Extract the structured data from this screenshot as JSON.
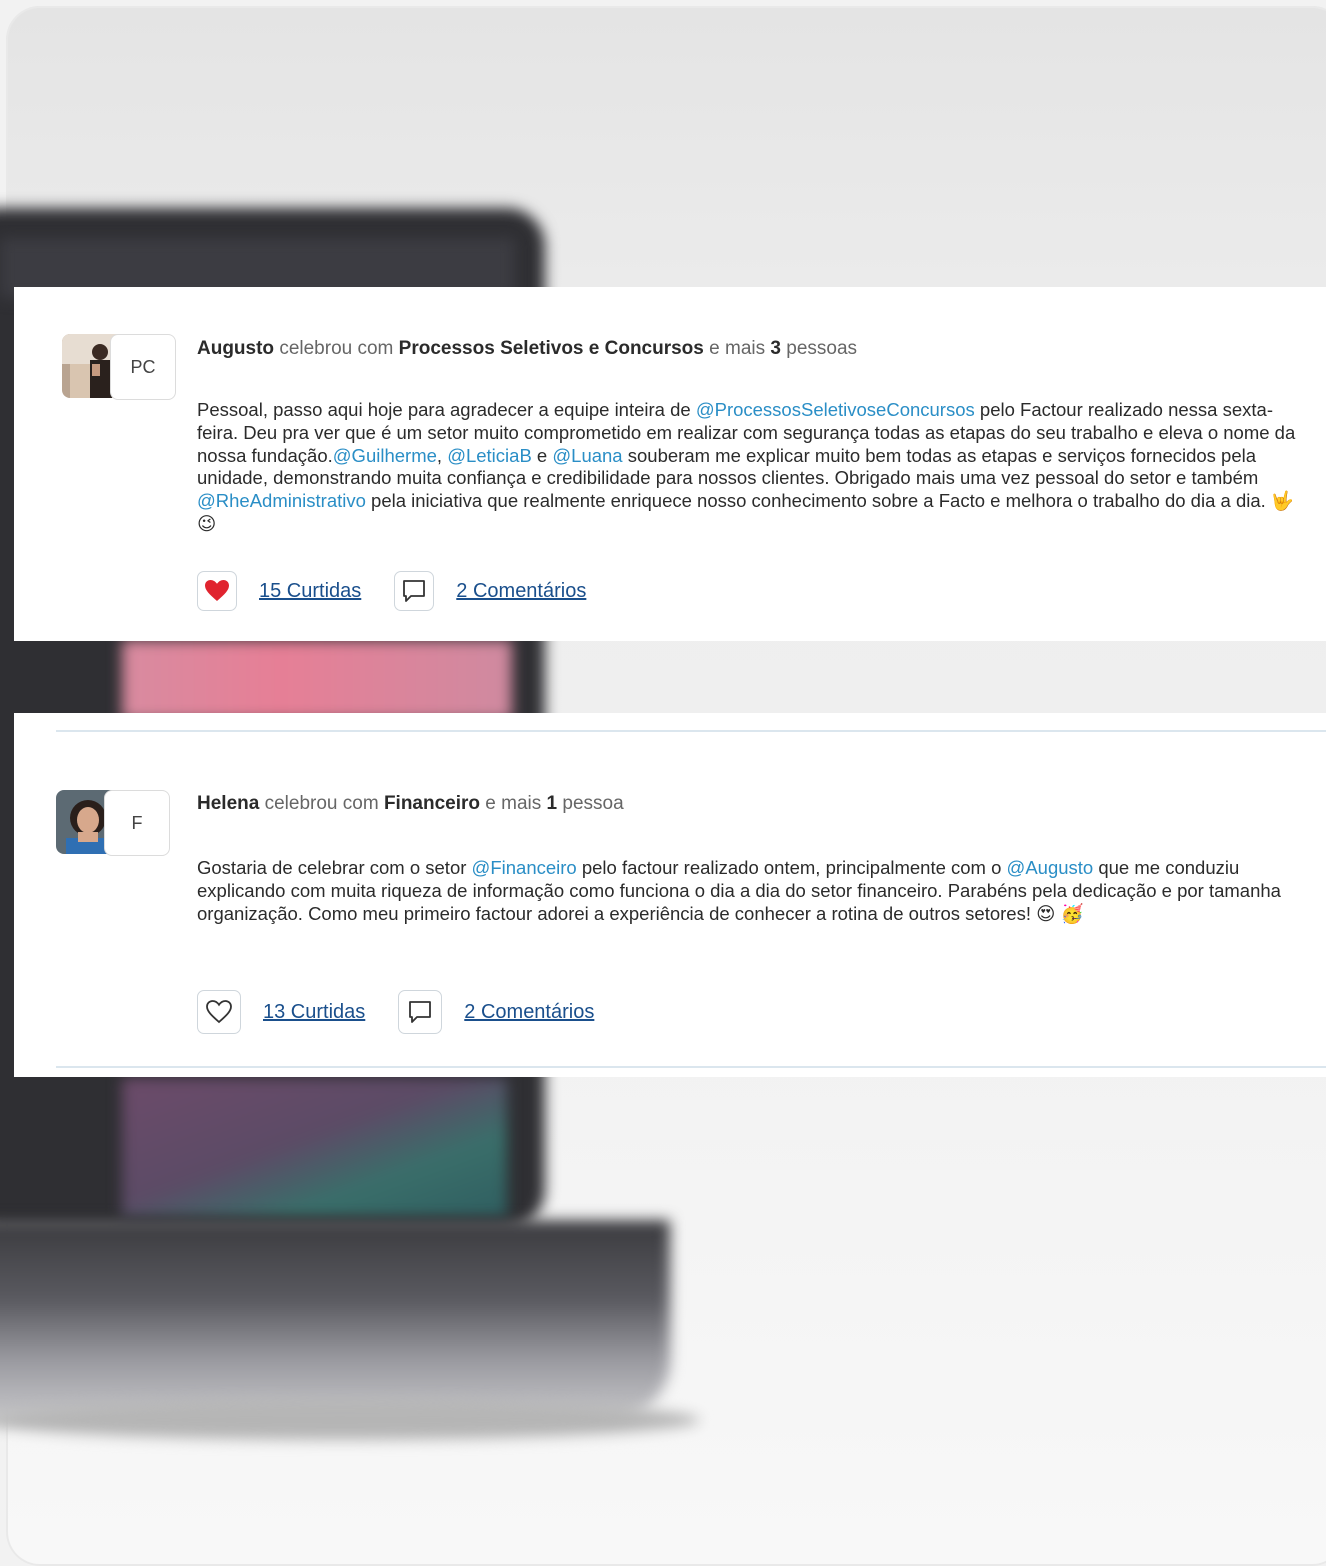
{
  "colors": {
    "mention": "#2a8ec6",
    "link": "#1a4f8c",
    "heart_filled": "#e0242f",
    "divider": "#dbe6ee"
  },
  "posts": [
    {
      "avatar_tag": "PC",
      "author": "Augusto",
      "verb": "celebrou com",
      "group": "Processos Seletivos e Concursos",
      "and_more": "e mais",
      "count": "3",
      "people": "pessoas",
      "body_parts": [
        {
          "t": "Pessoal, passo aqui hoje para agradecer a equipe inteira de "
        },
        {
          "t": "@ProcessosSeletivoseConcursos",
          "m": true
        },
        {
          "t": " pelo Factour realizado nessa sexta-feira. Deu pra ver que é um setor muito comprometido em realizar com segurança todas as etapas do seu trabalho e eleva o nome da nossa fundação."
        },
        {
          "t": "@Guilherme",
          "m": true
        },
        {
          "t": ", "
        },
        {
          "t": "@LeticiaB",
          "m": true
        },
        {
          "t": " e "
        },
        {
          "t": "@Luana",
          "m": true
        },
        {
          "t": " souberam me explicar muito bem todas as etapas e serviços fornecidos pela unidade, demonstrando muita confiança e credibilidade para nossos clientes. Obrigado mais uma vez pessoal do setor e também "
        },
        {
          "t": "@RheAdministrativo",
          "m": true
        },
        {
          "t": " pela iniciativa que realmente enriquece nosso conhecimento sobre a Facto e melhora o trabalho do dia a dia. 🤟 😉"
        }
      ],
      "likes_label": "15 Curtidas",
      "comments_label": "2 Comentários",
      "liked": true
    },
    {
      "avatar_tag": "F",
      "author": "Helena",
      "verb": "celebrou com",
      "group": "Financeiro",
      "and_more": "e mais",
      "count": "1",
      "people": "pessoa",
      "body_parts": [
        {
          "t": "Gostaria de celebrar com o setor "
        },
        {
          "t": "@Financeiro",
          "m": true
        },
        {
          "t": " pelo factour realizado ontem, principalmente com o "
        },
        {
          "t": "@Augusto",
          "m": true
        },
        {
          "t": " que me conduziu explicando com muita riqueza de informação como funciona o dia a dia do setor financeiro. Parabéns pela dedicação e por tamanha organização. Como meu primeiro factour adorei a experiência de conhecer a rotina de outros setores! 😍 🥳"
        }
      ],
      "likes_label": "13 Curtidas",
      "comments_label": "2 Comentários",
      "liked": false
    }
  ]
}
